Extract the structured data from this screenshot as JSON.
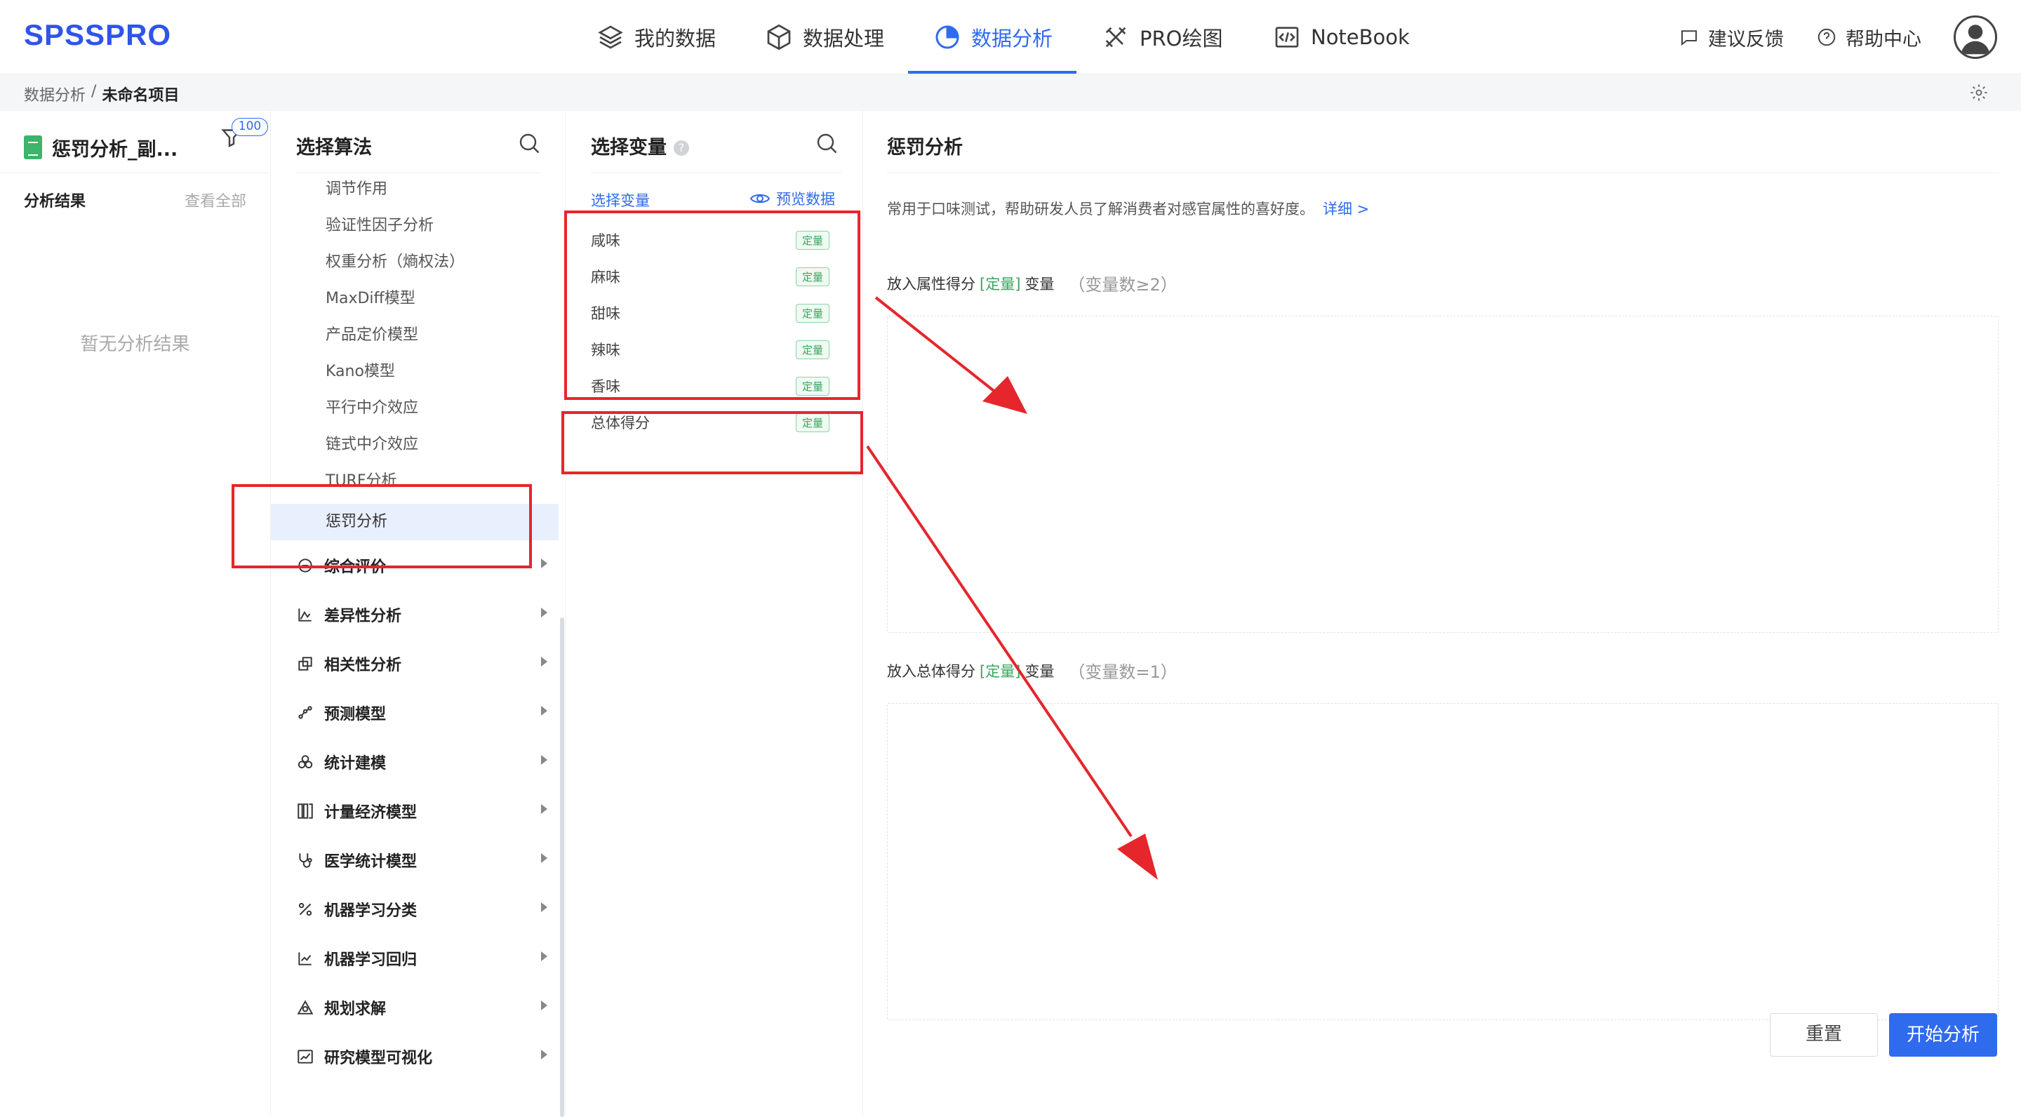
{
  "app": {
    "logo": "SPSSPRO",
    "nav": [
      {
        "label": "我的数据",
        "icon": "layers-icon"
      },
      {
        "label": "数据处理",
        "icon": "cube-icon"
      },
      {
        "label": "数据分析",
        "icon": "pie-chart-icon",
        "active": true
      },
      {
        "label": "PRO绘图",
        "icon": "pencil-ruler-icon"
      },
      {
        "label": "NoteBook",
        "icon": "code-icon"
      }
    ],
    "feedback_label": "建议反馈",
    "help_label": "帮助中心",
    "accent": "#2f6bed"
  },
  "breadcrumb": {
    "root": "数据分析",
    "separator": "/",
    "current": "未命名项目"
  },
  "results": {
    "project_name": "惩罚分析_副...",
    "filter_badge": "100",
    "title": "分析结果",
    "view_all": "查看全部",
    "empty": "暂无分析结果"
  },
  "algo": {
    "title": "选择算法",
    "sub_items": [
      "调节作用",
      "验证性因子分析",
      "权重分析（熵权法）",
      "MaxDiff模型",
      "产品定价模型",
      "Kano模型",
      "平行中介效应",
      "链式中介效应",
      "TURF分析",
      "惩罚分析"
    ],
    "selected": "惩罚分析",
    "categories": [
      {
        "label": "综合评价",
        "icon": "comment-icon"
      },
      {
        "label": "差异性分析",
        "icon": "mountain-chart-icon"
      },
      {
        "label": "相关性分析",
        "icon": "overlap-squares-icon"
      },
      {
        "label": "预测模型",
        "icon": "scatter-icon"
      },
      {
        "label": "统计建模",
        "icon": "circles-icon"
      },
      {
        "label": "计量经济模型",
        "icon": "columns-icon"
      },
      {
        "label": "医学统计模型",
        "icon": "stethoscope-icon"
      },
      {
        "label": "机器学习分类",
        "icon": "percent-icon"
      },
      {
        "label": "机器学习回归",
        "icon": "trend-chart-icon"
      },
      {
        "label": "规划求解",
        "icon": "triangle-icon"
      },
      {
        "label": "研究模型可视化",
        "icon": "line-chart-icon"
      }
    ]
  },
  "vars": {
    "title": "选择变量",
    "help": "?",
    "sub_title": "选择变量",
    "preview": "预览数据",
    "items": [
      {
        "name": "咸味",
        "tag": "定量"
      },
      {
        "name": "麻味",
        "tag": "定量"
      },
      {
        "name": "甜味",
        "tag": "定量"
      },
      {
        "name": "辣味",
        "tag": "定量"
      },
      {
        "name": "香味",
        "tag": "定量"
      },
      {
        "name": "总体得分",
        "tag": "定量"
      }
    ]
  },
  "config": {
    "title": "惩罚分析",
    "description": "常用于口味测试，帮助研发人员了解消费者对感官属性的喜好度。",
    "detail_link": "详细 >",
    "zone1": {
      "prefix": "放入属性得分",
      "tag": "[定量]",
      "suffix": "变量",
      "count": "（变量数≥2）"
    },
    "zone2": {
      "prefix": "放入总体得分",
      "tag": "[定量]",
      "suffix": "变量",
      "count": "（变量数=1）"
    },
    "reset": "重置",
    "start": "开始分析"
  },
  "annotation_color": "#e5262c"
}
